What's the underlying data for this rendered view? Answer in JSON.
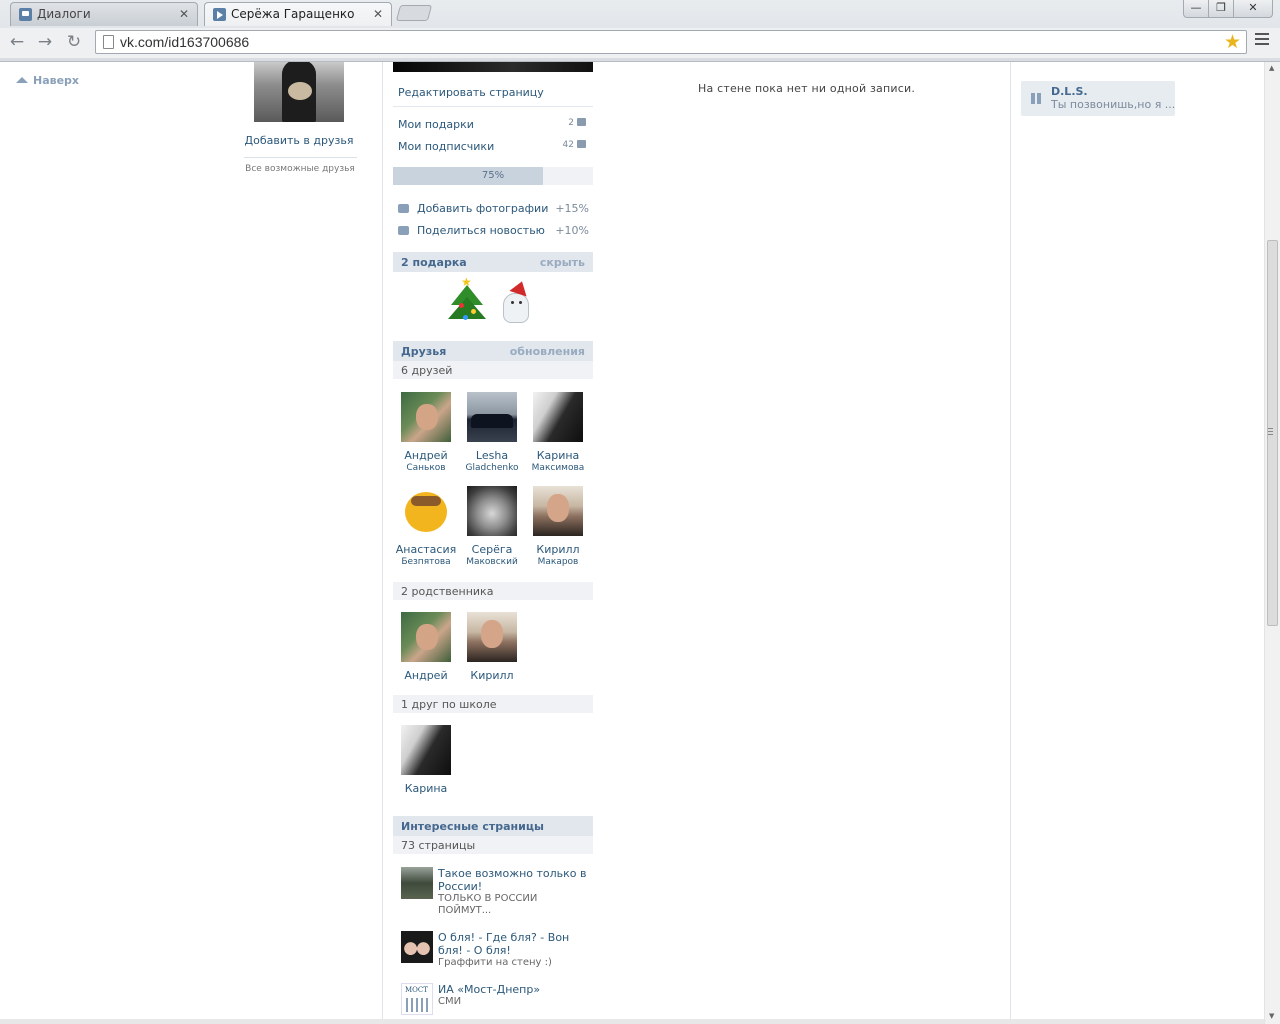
{
  "browser": {
    "tabs": [
      {
        "label": "Диалоги",
        "active": false
      },
      {
        "label": "Серёжа Гаращенко",
        "active": true
      }
    ],
    "url": "vk.com/id163700686",
    "window_buttons": {
      "minimize": "—",
      "maximize": "❐",
      "close": "✕"
    }
  },
  "left": {
    "to_top": "Наверх",
    "add_friend": "Добавить в друзья",
    "possible_friends": "Все возможные друзья"
  },
  "profile": {
    "edit_page": "Редактировать страницу",
    "gifts_link": "Мои подарки",
    "gifts_count": "2",
    "followers_link": "Мои подписчики",
    "followers_count": "42",
    "completeness": "75%",
    "completeness_value": 0.75,
    "tasks": [
      {
        "label": "Добавить фотографии",
        "bonus": "+15%"
      },
      {
        "label": "Поделиться новостью",
        "bonus": "+10%"
      }
    ]
  },
  "gifts_section": {
    "title": "2 подарка",
    "action": "скрыть"
  },
  "friends_section": {
    "title": "Друзья",
    "action": "обновления",
    "count_label": "6 друзей",
    "friends": [
      {
        "first": "Андрей",
        "last": "Саньков"
      },
      {
        "first": "Lesha",
        "last": "Gladchenko"
      },
      {
        "first": "Карина",
        "last": "Максимова"
      },
      {
        "first": "Анастасия",
        "last": "Безпятова"
      },
      {
        "first": "Серёга",
        "last": "Маковский"
      },
      {
        "first": "Кирилл",
        "last": "Макаров"
      }
    ],
    "relatives_label": "2 родственника",
    "relatives": [
      {
        "first": "Андрей"
      },
      {
        "first": "Кирилл"
      }
    ],
    "school_label": "1 друг по школе",
    "school": [
      {
        "first": "Карина"
      }
    ]
  },
  "pages_section": {
    "title": "Интересные страницы",
    "count_label": "73 страницы",
    "pages": [
      {
        "title": "Такое возможно только в России!",
        "desc": "ТОЛЬКО В РОССИИ ПОЙМУТ..."
      },
      {
        "title": "О бля! - Где бля? - Вон бля! - О бля!",
        "desc": "Граффити на стену :)"
      },
      {
        "title": "ИА «Мост-Днепр»",
        "desc": "СМИ"
      }
    ]
  },
  "wall": {
    "empty_message": "На стене пока нет ни одной записи."
  },
  "audio": {
    "artist": "D.L.S.",
    "song": "Ты позвонишь,но я ..."
  }
}
